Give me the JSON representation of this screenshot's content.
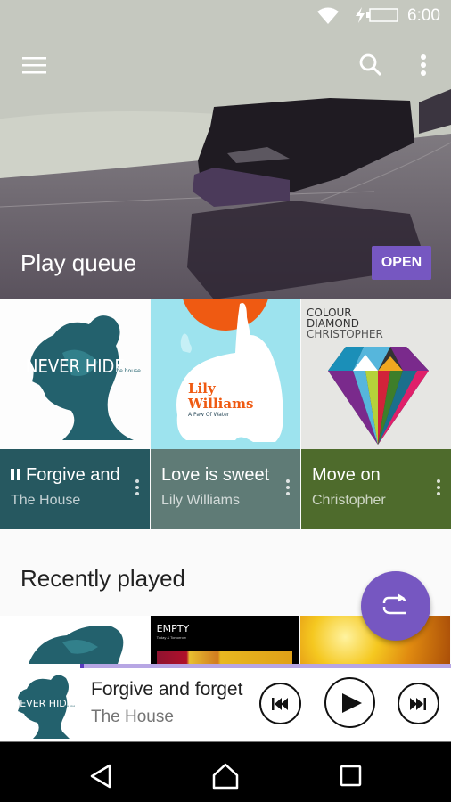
{
  "status_bar": {
    "time": "6:00",
    "icons": [
      "wifi-icon",
      "charging-icon",
      "battery-icon"
    ]
  },
  "toolbar": {
    "menu_icon": "hamburger-menu-icon",
    "search_icon": "search-icon",
    "more_icon": "more-vertical-icon"
  },
  "hero": {
    "title": "Play queue",
    "open_label": "OPEN",
    "accent": "#7657c1"
  },
  "queue": [
    {
      "title": "Forgive and forget",
      "artist": "The House",
      "playing": true,
      "state_icon": "pause-icon",
      "color": "#265860",
      "album_art": {
        "title": "NEVER HIDE",
        "subtitle": "the house"
      }
    },
    {
      "title": "Love is sweet",
      "artist": "Lily Williams",
      "playing": false,
      "color": "#5f7b76",
      "album_art": {
        "title_line1": "Lily",
        "title_line2": "Williams",
        "subtitle": "A Paw Of Water"
      }
    },
    {
      "title": "Move on",
      "artist": "Christopher",
      "playing": false,
      "color": "#4e6b2c",
      "album_art": {
        "line1": "COLOUR",
        "line2": "DIAMOND",
        "line3": "CHRISTOPHER"
      }
    }
  ],
  "recent": {
    "title": "Recently played",
    "items": [
      {
        "art": "never-hide-cover"
      },
      {
        "art": "empty-cover",
        "title": "EMPTY",
        "subtitle": "Today & Tomorrow"
      },
      {
        "art": "fire-cover"
      }
    ]
  },
  "fab": {
    "icon": "shuffle-repeat-icon"
  },
  "now_playing": {
    "title": "Forgive and forget",
    "artist": "The House",
    "progress_percent": 1,
    "art": {
      "title": "NEVER HIDE",
      "subtitle": "the house"
    },
    "controls": [
      "previous-icon",
      "play-icon",
      "next-icon"
    ]
  },
  "nav_bar": [
    "back-icon",
    "home-icon",
    "recents-icon"
  ]
}
